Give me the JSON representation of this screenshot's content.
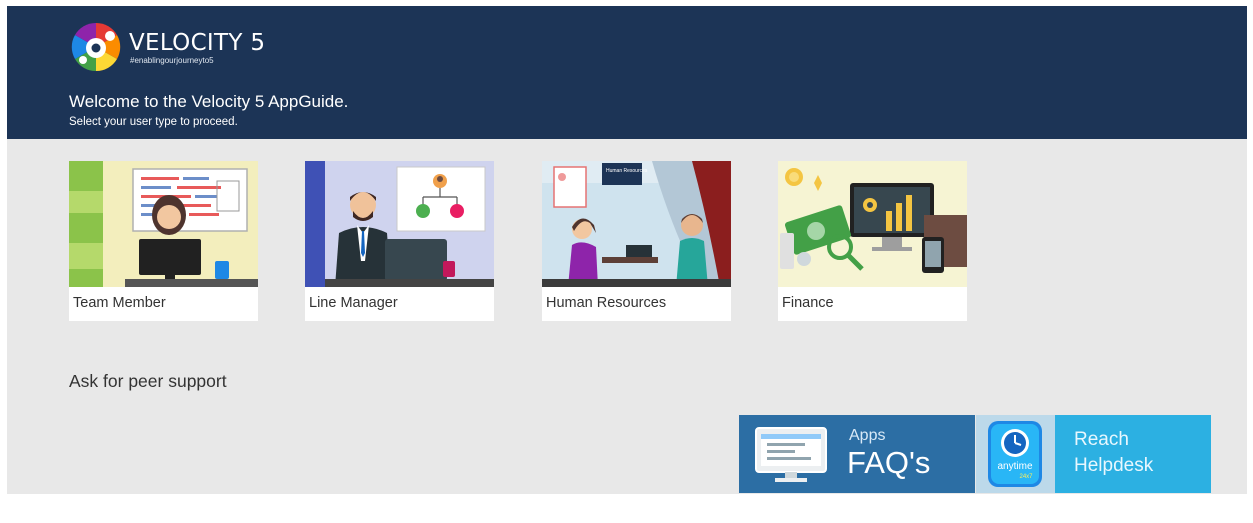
{
  "brand": {
    "name": "VELOCITY 5",
    "tagline": "#enablingourjourneyto5"
  },
  "welcome": {
    "title": "Welcome to the Velocity 5 AppGuide.",
    "subtitle": "Select your user type to proceed."
  },
  "user_types": [
    {
      "label": "Team Member"
    },
    {
      "label": "Line Manager"
    },
    {
      "label": "Human Resources",
      "sign": "Human Resources"
    },
    {
      "label": "Finance"
    }
  ],
  "peer_support": {
    "label": "Ask for peer support"
  },
  "actions": {
    "faq": {
      "small": "Apps",
      "big": "FAQ's"
    },
    "helpdesk": {
      "line1": "Reach",
      "line2": "Helpdesk",
      "icon_text": "anytime",
      "icon_subtext": "24x7"
    }
  },
  "colors": {
    "header_bg": "#1c3456",
    "page_bg": "#e8e8e8",
    "faq_bg": "#2c6ea4",
    "helpdesk_bg": "#2cb0e2"
  },
  "icons": [
    "velocity-logo-icon",
    "monitor-icon",
    "clock-icon"
  ]
}
